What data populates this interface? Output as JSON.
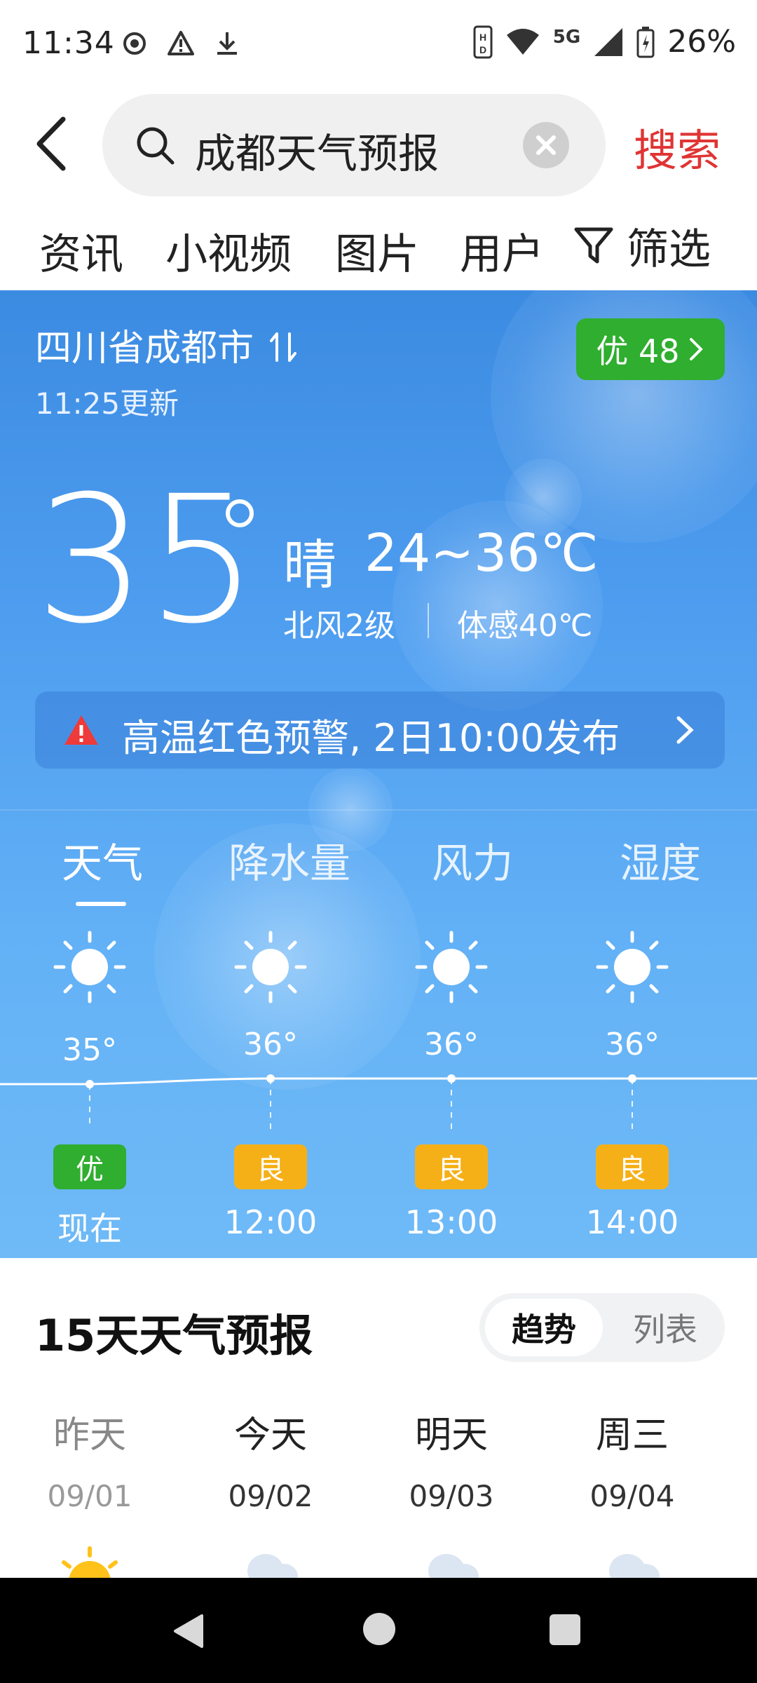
{
  "status_bar": {
    "time": "11:34",
    "network": "5G",
    "battery": "26%"
  },
  "search": {
    "query": "成都天气预报",
    "submit_label": "搜索"
  },
  "filter_tabs": [
    "资讯",
    "小视频",
    "图片",
    "用户"
  ],
  "filter_button": "筛选",
  "weather": {
    "location": "四川省成都市",
    "updated": "11:25更新",
    "aqi_pill": "优 48",
    "current_temp": "35",
    "condition": "晴",
    "range": "24~36℃",
    "wind": "北风2级",
    "feels_like": "体感40℃",
    "alert": "高温红色预警, 2日10:00发布",
    "tabs": [
      "天气",
      "降水量",
      "风力",
      "湿度"
    ],
    "hourly": [
      {
        "temp": "35°",
        "aqi": "优",
        "level": "good",
        "label": "现在"
      },
      {
        "temp": "36°",
        "aqi": "良",
        "level": "ok",
        "label": "12:00"
      },
      {
        "temp": "36°",
        "aqi": "良",
        "level": "ok",
        "label": "13:00"
      },
      {
        "temp": "36°",
        "aqi": "良",
        "level": "ok",
        "label": "14:00"
      }
    ]
  },
  "forecast": {
    "title": "15天天气预报",
    "view_trend": "趋势",
    "view_list": "列表",
    "days": [
      {
        "name": "昨天",
        "date": "09/01",
        "icon": "sun-icon"
      },
      {
        "name": "今天",
        "date": "09/02",
        "icon": "cloud-sun-icon"
      },
      {
        "name": "明天",
        "date": "09/03",
        "icon": "cloud-sun-icon"
      },
      {
        "name": "周三",
        "date": "09/04",
        "icon": "cloud-sun-icon"
      }
    ]
  },
  "colors": {
    "accent_red": "#e03434",
    "aqi_good": "#2fae2f",
    "aqi_ok": "#f5b018",
    "sky_blue": "#4f9ef0"
  }
}
